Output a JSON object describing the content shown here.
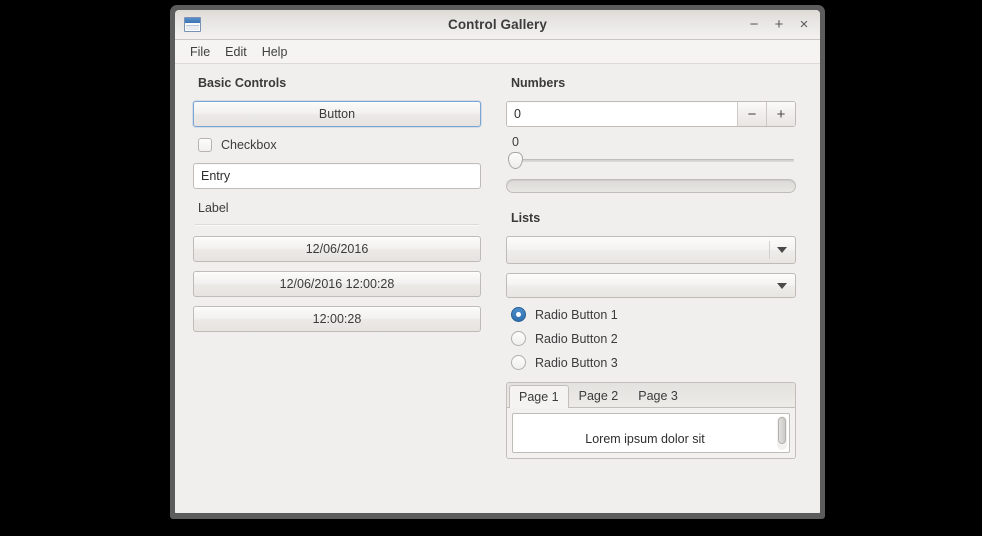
{
  "window": {
    "title": "Control Gallery",
    "icon": "window-icon",
    "controls": {
      "minimize": "−",
      "maximize": "+",
      "close": "×"
    }
  },
  "menubar": {
    "items": [
      {
        "label": "File"
      },
      {
        "label": "Edit"
      },
      {
        "label": "Help"
      }
    ]
  },
  "basic_controls": {
    "heading": "Basic Controls",
    "button_label": "Button",
    "checkbox_label": "Checkbox",
    "checkbox_checked": false,
    "entry_value": "Entry",
    "label_text": "Label",
    "date_button": "12/06/2016",
    "datetime_button": "12/06/2016 12:00:28",
    "time_button": "12:00:28"
  },
  "numbers": {
    "heading": "Numbers",
    "spin_value": "0",
    "spin_decrement": "−",
    "spin_increment": "+",
    "slider_value": "0",
    "progress_value": "0"
  },
  "lists": {
    "heading": "Lists",
    "combo_editable_value": "",
    "combo_value": "",
    "radios": [
      {
        "label": "Radio Button 1",
        "selected": true
      },
      {
        "label": "Radio Button 2",
        "selected": false
      },
      {
        "label": "Radio Button 3",
        "selected": false
      }
    ],
    "tabs": [
      {
        "label": "Page 1",
        "active": true
      },
      {
        "label": "Page 2",
        "active": false
      },
      {
        "label": "Page 3",
        "active": false
      }
    ],
    "textview_content": "Lorem ipsum dolor sit"
  }
}
